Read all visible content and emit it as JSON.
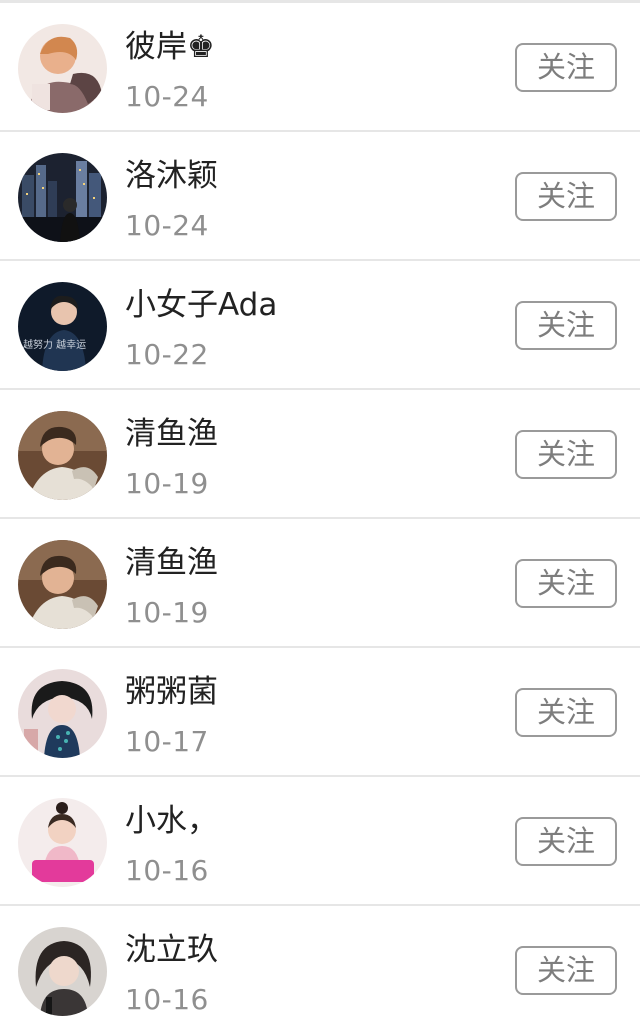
{
  "users": [
    {
      "name": "彼岸♚",
      "date": "10-24",
      "follow_label": "关注"
    },
    {
      "name": "洛沐颖",
      "date": "10-24",
      "follow_label": "关注"
    },
    {
      "name": "小女子Ada",
      "date": "10-22",
      "follow_label": "关注",
      "avatar_text": "越努力 越幸运"
    },
    {
      "name": "清鱼渔",
      "date": "10-19",
      "follow_label": "关注"
    },
    {
      "name": "清鱼渔",
      "date": "10-19",
      "follow_label": "关注"
    },
    {
      "name": "粥粥菌",
      "date": "10-17",
      "follow_label": "关注"
    },
    {
      "name": "小水，",
      "date": "10-16",
      "follow_label": "关注"
    },
    {
      "name": "沈立玖",
      "date": "10-16",
      "follow_label": "关注"
    }
  ]
}
